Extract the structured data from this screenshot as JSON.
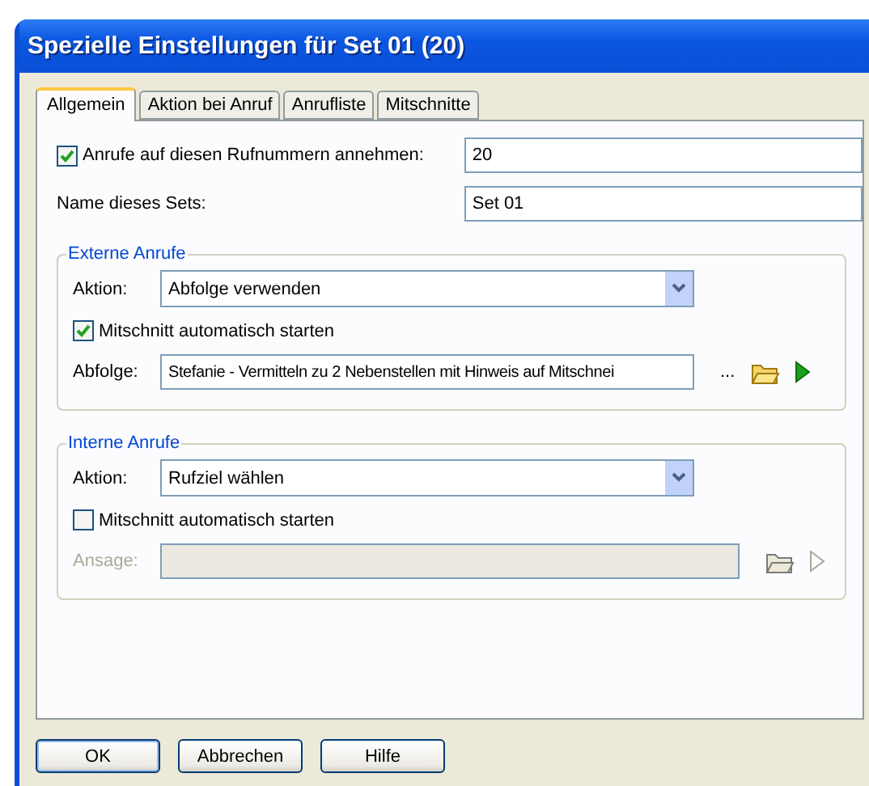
{
  "window": {
    "title": "Spezielle Einstellungen für Set 01 (20)"
  },
  "tabs": [
    {
      "label": "Allgemein",
      "selected": true
    },
    {
      "label": "Aktion bei Anruf",
      "selected": false
    },
    {
      "label": "Anrufliste",
      "selected": false
    },
    {
      "label": "Mitschnitte",
      "selected": false
    }
  ],
  "accept_calls": {
    "label": "Anrufe auf diesen Rufnummern annehmen:",
    "checked": true,
    "value": "20"
  },
  "set_name": {
    "label": "Name dieses Sets:",
    "value": "Set 01"
  },
  "groups": [
    {
      "title": "Externe Anrufe",
      "action": {
        "label": "Aktion:",
        "value": "Abfolge verwenden"
      },
      "record": {
        "label": "Mitschnitt automatisch starten",
        "checked": true
      },
      "source": {
        "label": "Abfolge:",
        "value": "Stefanie - Vermitteln zu 2 Nebenstellen mit Hinweis auf Mitschnei",
        "browse": "...",
        "disabled": false
      }
    },
    {
      "title": "Interne Anrufe",
      "action": {
        "label": "Aktion:",
        "value": "Rufziel wählen"
      },
      "record": {
        "label": "Mitschnitt automatisch starten",
        "checked": false
      },
      "source": {
        "label": "Ansage:",
        "disabled": true
      }
    }
  ],
  "buttons": [
    "OK",
    "Abbrechen",
    "Hilfe"
  ]
}
